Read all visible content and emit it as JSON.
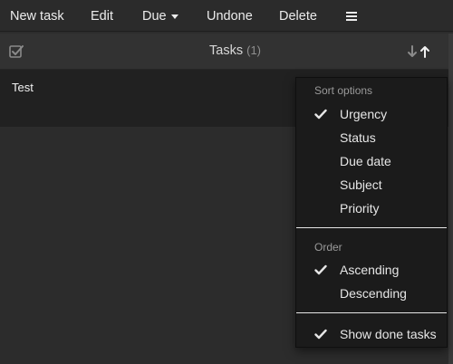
{
  "toolbar": {
    "new_task": "New task",
    "edit": "Edit",
    "due": "Due",
    "undone": "Undone",
    "delete": "Delete",
    "menu_icon": "hamburger-icon"
  },
  "panel": {
    "title": "Tasks",
    "count": "(1)",
    "select_all_icon": "checkbox-checked-icon",
    "sort_icon": "sort-arrows-icon"
  },
  "tasks": [
    {
      "subject": "Test"
    }
  ],
  "sort_menu": {
    "sort_header": "Sort options",
    "sort_items": [
      {
        "label": "Urgency",
        "checked": true
      },
      {
        "label": "Status",
        "checked": false
      },
      {
        "label": "Due date",
        "checked": false
      },
      {
        "label": "Subject",
        "checked": false
      },
      {
        "label": "Priority",
        "checked": false
      }
    ],
    "order_header": "Order",
    "order_items": [
      {
        "label": "Ascending",
        "checked": true
      },
      {
        "label": "Descending",
        "checked": false
      }
    ],
    "show_done": {
      "label": "Show done tasks",
      "checked": true
    }
  },
  "colors": {
    "background": "#2c2c2c",
    "menu_background": "#1b1b1b",
    "task_list_background": "#212121",
    "text": "#e8e8e8",
    "muted_text": "#9a9a9a"
  }
}
